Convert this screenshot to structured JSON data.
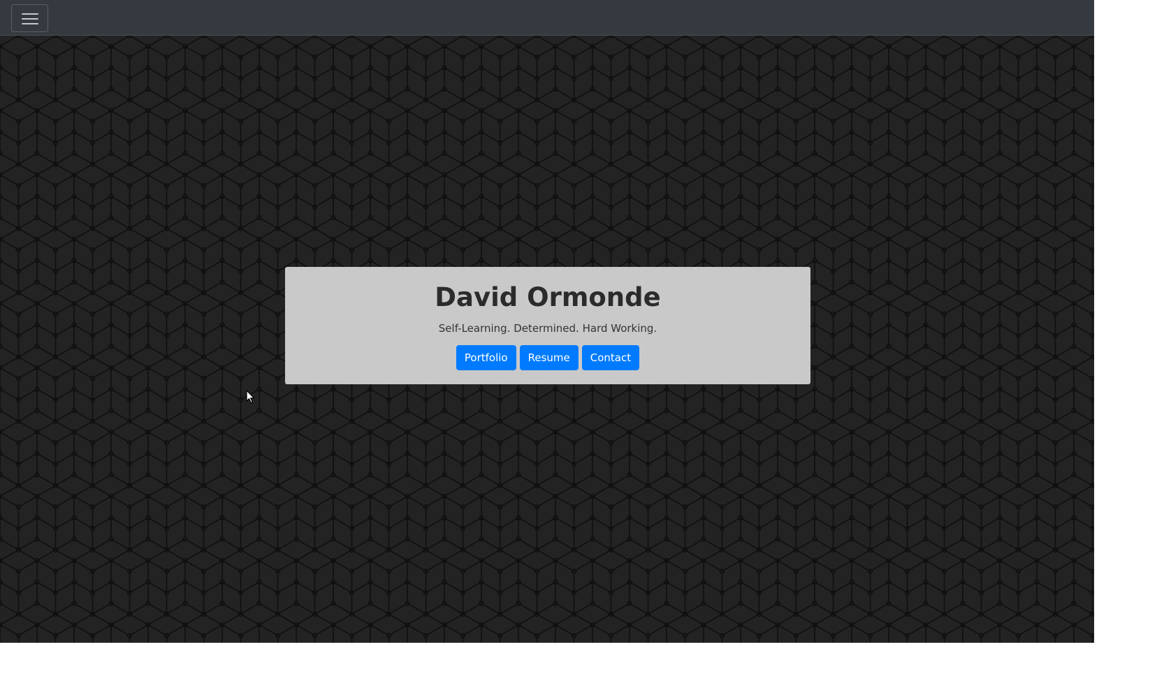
{
  "navbar": {
    "toggle_icon": "hamburger-menu-icon",
    "background_color": "#343a40"
  },
  "hero": {
    "background_color": "#242424",
    "pattern": "hexagon-cube-line-pattern"
  },
  "card": {
    "name": "David Ormonde",
    "tagline": "Self-Learning. Determined. Hard Working.",
    "buttons": [
      {
        "label": "Portfolio"
      },
      {
        "label": "Resume"
      },
      {
        "label": "Contact"
      }
    ],
    "button_color": "#007bff"
  },
  "cursor": {
    "icon": "mouse-pointer-icon"
  }
}
